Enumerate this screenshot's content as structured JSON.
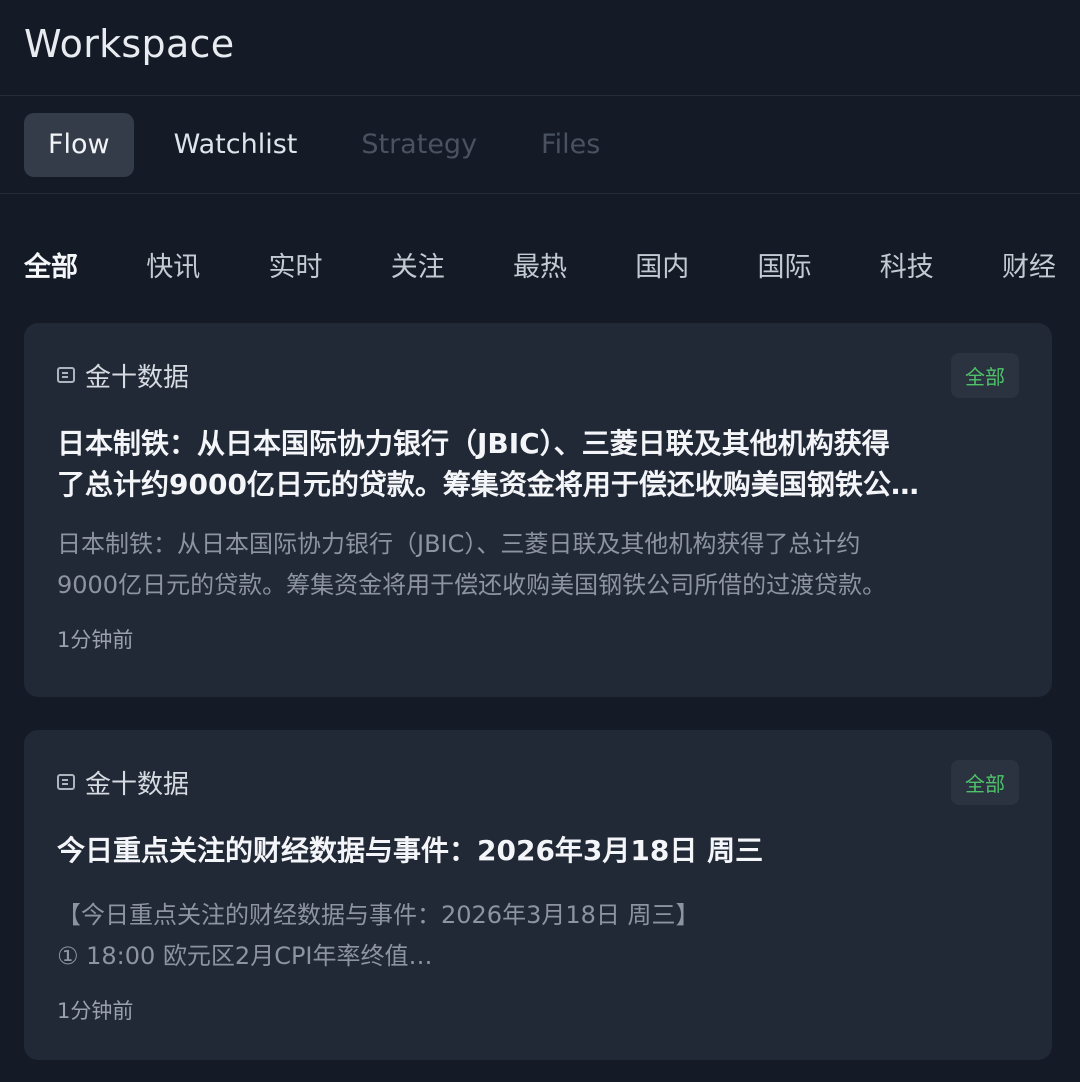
{
  "header": {
    "title": "Workspace"
  },
  "tabs": [
    {
      "label": "Flow",
      "state": "active"
    },
    {
      "label": "Watchlist",
      "state": "normal"
    },
    {
      "label": "Strategy",
      "state": "disabled"
    },
    {
      "label": "Files",
      "state": "disabled"
    }
  ],
  "categories": [
    "全部",
    "快讯",
    "实时",
    "关注",
    "最热",
    "国内",
    "国际",
    "科技",
    "财经"
  ],
  "active_category": "全部",
  "cards": [
    {
      "source": "金十数据",
      "source_icon": "news-icon",
      "badge": "全部",
      "title_line1": "日本制铁：从日本国际协力银行（JBIC）、三菱日联及其他机构获得",
      "title_line2": "了总计约9000亿日元的贷款。筹集资金将用于偿还收购美国钢铁公…",
      "summary_line1": "日本制铁：从日本国际协力银行（JBIC）、三菱日联及其他机构获得了总计约",
      "summary_line2": "9000亿日元的贷款。筹集资金将用于偿还收购美国钢铁公司所借的过渡贷款。",
      "time": "1分钟前"
    },
    {
      "source": "金十数据",
      "source_icon": "news-icon",
      "badge": "全部",
      "title_line1": "今日重点关注的财经数据与事件：2026年3月18日 周三",
      "summary_line1": "【今日重点关注的财经数据与事件：2026年3月18日 周三】",
      "summary_line2": "① 18:00 欧元区2月CPI年率终值…",
      "time": "1分钟前"
    }
  ],
  "colors": {
    "background": "#141a26",
    "card": "#212836",
    "active_tab": "#343c49",
    "badge_text": "#4fc26a"
  }
}
